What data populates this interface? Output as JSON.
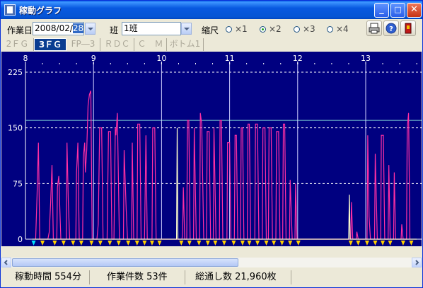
{
  "window": {
    "title": "稼動グラフ",
    "minimize_label": "_",
    "maximize_label": "□",
    "close_label": "✕"
  },
  "toolbar": {
    "date_label": "作業日",
    "date_prefix": "2008/02/",
    "date_selected": "28",
    "shift_label": "班",
    "shift_value": "1班",
    "scale_label": "縮尺",
    "scale_options": [
      "×1",
      "×2",
      "×3",
      "×4"
    ],
    "scale_selected": "×2",
    "icons": [
      "print-icon",
      "help-icon",
      "exit-icon"
    ]
  },
  "tabs": [
    "2ＦＧ",
    "3ＦＧ",
    "FP―3",
    "ＲＤＣ",
    "Ｃ　Ｍ",
    "ボトム1"
  ],
  "active_tab": "3ＦＧ",
  "chart_data": {
    "type": "line",
    "x_unit": "hour",
    "x_ticks": [
      "8",
      "9",
      "10",
      "11",
      "12",
      "13"
    ],
    "y_ticks": [
      "225",
      "150",
      "75",
      "0"
    ],
    "ylim": [
      0,
      225
    ],
    "reference_line": 160,
    "series": [
      {
        "color": "#ff2fa4",
        "points": [
          [
            8.15,
            0
          ],
          [
            8.17,
            60
          ],
          [
            8.19,
            130
          ],
          [
            8.21,
            0
          ],
          [
            8.33,
            0
          ],
          [
            8.35,
            10
          ],
          [
            8.37,
            50
          ],
          [
            8.39,
            100
          ],
          [
            8.41,
            0
          ],
          [
            8.46,
            0
          ],
          [
            8.47,
            70
          ],
          [
            8.49,
            85
          ],
          [
            8.52,
            0
          ],
          [
            8.6,
            0
          ],
          [
            8.61,
            130
          ],
          [
            8.63,
            50
          ],
          [
            8.65,
            0
          ],
          [
            8.74,
            0
          ],
          [
            8.75,
            90
          ],
          [
            8.77,
            130
          ],
          [
            8.79,
            0
          ],
          [
            8.84,
            0
          ],
          [
            8.85,
            110
          ],
          [
            8.87,
            130
          ],
          [
            8.88,
            90
          ],
          [
            8.9,
            120
          ],
          [
            8.92,
            180
          ],
          [
            8.94,
            195
          ],
          [
            8.96,
            200
          ],
          [
            8.98,
            0
          ],
          [
            9.05,
            0
          ],
          [
            9.07,
            20
          ],
          [
            9.09,
            150
          ],
          [
            9.12,
            150
          ],
          [
            9.14,
            0
          ],
          [
            9.2,
            0
          ],
          [
            9.22,
            145
          ],
          [
            9.25,
            145
          ],
          [
            9.27,
            0
          ],
          [
            9.3,
            0
          ],
          [
            9.32,
            150
          ],
          [
            9.33,
            140
          ],
          [
            9.35,
            170
          ],
          [
            9.38,
            0
          ],
          [
            9.44,
            0
          ],
          [
            9.45,
            120
          ],
          [
            9.48,
            40
          ],
          [
            9.5,
            0
          ],
          [
            9.56,
            0
          ],
          [
            9.57,
            130
          ],
          [
            9.59,
            0
          ],
          [
            9.64,
            0
          ],
          [
            9.65,
            155
          ],
          [
            9.68,
            155
          ],
          [
            9.7,
            0
          ],
          [
            9.75,
            0
          ],
          [
            9.77,
            140
          ],
          [
            9.79,
            0
          ],
          [
            9.86,
            0
          ],
          [
            9.87,
            150
          ],
          [
            9.9,
            150
          ],
          [
            9.92,
            0
          ],
          [
            10.3,
            0
          ],
          [
            10.31,
            10
          ],
          [
            10.32,
            70
          ],
          [
            10.34,
            0
          ],
          [
            10.37,
            0
          ],
          [
            10.38,
            160
          ],
          [
            10.4,
            160
          ],
          [
            10.42,
            0
          ],
          [
            10.47,
            0
          ],
          [
            10.48,
            150
          ],
          [
            10.51,
            0
          ],
          [
            10.56,
            0
          ],
          [
            10.57,
            170
          ],
          [
            10.59,
            155
          ],
          [
            10.62,
            0
          ],
          [
            10.66,
            0
          ],
          [
            10.67,
            145
          ],
          [
            10.7,
            145
          ],
          [
            10.72,
            0
          ],
          [
            10.76,
            0
          ],
          [
            10.77,
            150
          ],
          [
            10.8,
            0
          ],
          [
            10.85,
            0
          ],
          [
            10.86,
            160
          ],
          [
            10.88,
            160
          ],
          [
            10.9,
            0
          ],
          [
            10.96,
            0
          ],
          [
            10.97,
            130
          ],
          [
            11.0,
            130
          ],
          [
            11.02,
            0
          ],
          [
            11.07,
            0
          ],
          [
            11.08,
            140
          ],
          [
            11.1,
            140
          ],
          [
            11.12,
            0
          ],
          [
            11.16,
            0
          ],
          [
            11.17,
            150
          ],
          [
            11.19,
            150
          ],
          [
            11.21,
            0
          ],
          [
            11.26,
            0
          ],
          [
            11.27,
            155
          ],
          [
            11.29,
            155
          ],
          [
            11.31,
            0
          ],
          [
            11.37,
            0
          ],
          [
            11.38,
            155
          ],
          [
            11.41,
            155
          ],
          [
            11.43,
            0
          ],
          [
            11.48,
            0
          ],
          [
            11.49,
            150
          ],
          [
            11.52,
            150
          ],
          [
            11.54,
            0
          ],
          [
            11.57,
            0
          ],
          [
            11.58,
            150
          ],
          [
            11.61,
            150
          ],
          [
            11.63,
            0
          ],
          [
            11.68,
            0
          ],
          [
            11.69,
            145
          ],
          [
            11.72,
            145
          ],
          [
            11.74,
            0
          ],
          [
            11.78,
            0
          ],
          [
            11.79,
            155
          ],
          [
            11.81,
            155
          ],
          [
            11.83,
            0
          ],
          [
            11.88,
            0
          ],
          [
            11.89,
            80
          ],
          [
            11.92,
            0
          ],
          [
            11.96,
            0
          ],
          [
            11.97,
            75
          ],
          [
            11.99,
            0
          ],
          [
            12.78,
            0
          ],
          [
            12.79,
            50
          ],
          [
            12.81,
            0
          ],
          [
            12.86,
            0
          ],
          [
            12.87,
            10
          ],
          [
            12.89,
            0
          ],
          [
            13.02,
            0
          ],
          [
            13.03,
            140
          ],
          [
            13.05,
            30
          ],
          [
            13.07,
            0
          ],
          [
            13.13,
            0
          ],
          [
            13.14,
            115
          ],
          [
            13.17,
            0
          ],
          [
            13.22,
            0
          ],
          [
            13.23,
            140
          ],
          [
            13.26,
            140
          ],
          [
            13.28,
            0
          ],
          [
            13.33,
            0
          ],
          [
            13.34,
            100
          ],
          [
            13.36,
            0
          ],
          [
            13.41,
            0
          ],
          [
            13.42,
            90
          ],
          [
            13.44,
            0
          ],
          [
            13.52,
            0
          ],
          [
            13.53,
            20
          ],
          [
            13.55,
            0
          ],
          [
            13.6,
            0
          ],
          [
            13.61,
            150
          ],
          [
            13.63,
            170
          ],
          [
            13.65,
            0
          ]
        ]
      },
      {
        "color": "#ffffcc",
        "points": [
          [
            8.1,
            0
          ],
          [
            10.22,
            0
          ],
          [
            10.23,
            150
          ],
          [
            10.24,
            0
          ],
          [
            12.75,
            0
          ],
          [
            12.76,
            60
          ],
          [
            12.77,
            0
          ],
          [
            13.75,
            0
          ]
        ]
      }
    ],
    "markers_hours": [
      8.12,
      8.25,
      8.43,
      8.56,
      8.7,
      8.82,
      8.97,
      9.1,
      9.24,
      9.37,
      9.51,
      9.64,
      9.75,
      9.86,
      9.97,
      10.29,
      10.41,
      10.55,
      10.68,
      10.79,
      10.92,
      11.06,
      11.19,
      11.29,
      11.41,
      11.54,
      11.65,
      11.77,
      11.89,
      12.01,
      12.78,
      12.89,
      13.02,
      13.14,
      13.25,
      13.36,
      13.55,
      13.67
    ],
    "marker_color": "#ffd000",
    "start_marker_color": "#00e5ff"
  },
  "status": {
    "operating_time": "稼動時間 554分",
    "job_count": "作業件数 53件",
    "total_sheets": "総通し数 21,960枚"
  }
}
